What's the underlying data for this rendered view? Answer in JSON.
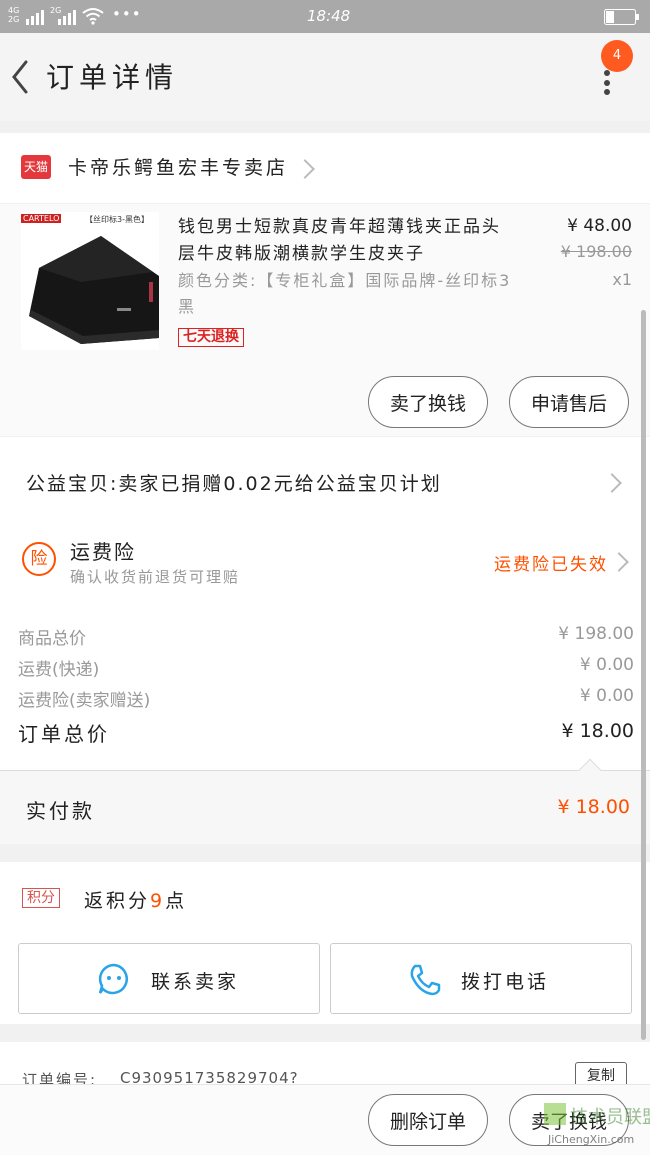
{
  "status_bar": {
    "signal_1": "4G",
    "signal_2": "2G",
    "time": "18:48",
    "dots": "•••"
  },
  "header": {
    "title": "订单详情",
    "badge_count": "4"
  },
  "shop": {
    "badge": "天猫",
    "name": "卡帝乐鳄鱼宏丰专卖店"
  },
  "product": {
    "thumb_brand": "CARTELO",
    "thumb_tag": "【丝印标3-黑色】",
    "title": "钱包男士短款真皮青年超薄钱夹正品头层牛皮韩版潮横款学生皮夹子",
    "sku": "颜色分类:【专柜礼盒】国际品牌-丝印标3黑",
    "price": "¥ 48.00",
    "original_price": "¥ 198.00",
    "qty": "x1",
    "return_tag": "七天退换"
  },
  "item_actions": {
    "buy_again": "卖了换钱",
    "after_sale": "申请售后"
  },
  "charity": {
    "text": "公益宝贝:卖家已捐赠0.02元给公益宝贝计划"
  },
  "insurance": {
    "icon_char": "险",
    "title": "运费险",
    "subtitle": "确认收货前退货可理赔",
    "status": "运费险已失效"
  },
  "price_rows": [
    {
      "label": "商品总价",
      "value": "¥ 198.00"
    },
    {
      "label": "运费(快递)",
      "value": "¥ 0.00"
    },
    {
      "label": "运费险(卖家赠送)",
      "value": "¥ 0.00"
    }
  ],
  "order_total": {
    "label": "订单总价",
    "value": "¥ 18.00"
  },
  "paid": {
    "label": "实付款",
    "value": "¥ 18.00"
  },
  "points": {
    "badge": "积分",
    "text_prefix": "返积分",
    "points": "9",
    "text_suffix": "点"
  },
  "contact": {
    "seller": "联系卖家",
    "phone": "拨打电话"
  },
  "order_info": {
    "number_label": "订单编号:",
    "number": "C930951735829704?",
    "copy": "复制"
  },
  "bottom_bar": {
    "delete": "删除订单",
    "sell": "卖了换钱"
  },
  "watermark": {
    "line1": "技术员联盟",
    "line2": "JiChengXin.com"
  },
  "colors": {
    "accent": "#ff5000",
    "tmall_red": "#e4393c",
    "points_red": "#d9534f"
  }
}
